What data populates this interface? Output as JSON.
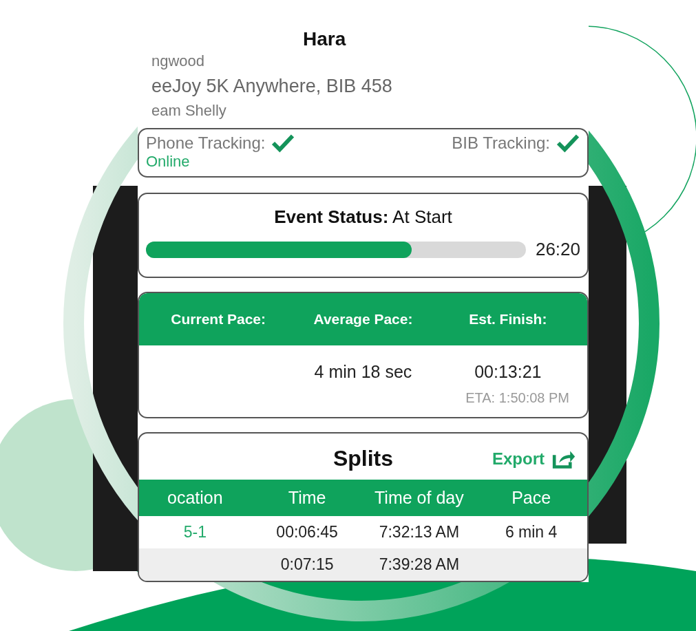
{
  "runner": {
    "name": "Hara",
    "club": "ngwood",
    "event": "eeJoy 5K Anywhere, BIB 458",
    "team": "eam Shelly"
  },
  "tracking": {
    "phone_label": "Phone Tracking:",
    "phone_ok": true,
    "phone_status": "Online",
    "bib_label": "BIB Tracking:",
    "bib_ok": true
  },
  "event_status": {
    "label": "Event Status:",
    "value": "At Start",
    "level": 0.7,
    "time": "26:20"
  },
  "pace": {
    "columns": [
      "Current Pace:",
      "Average Pace:",
      "Est. Finish:"
    ],
    "values": [
      "4 min 18 sec",
      "00:13:21"
    ],
    "eta": "ETA: 1:50:08 PM"
  },
  "splits": {
    "title": "Splits",
    "export": "Export",
    "columns": [
      "ocation",
      "Time",
      "Time of day",
      "Pace"
    ],
    "rows": [
      {
        "shaded": false,
        "cells": [
          "5-1",
          "00:06:45",
          "7:32:13 AM",
          "6 min 4"
        ]
      },
      {
        "shaded": true,
        "cells": [
          null,
          "0:07:15",
          "7:39:28 AM",
          null
        ]
      }
    ]
  }
}
